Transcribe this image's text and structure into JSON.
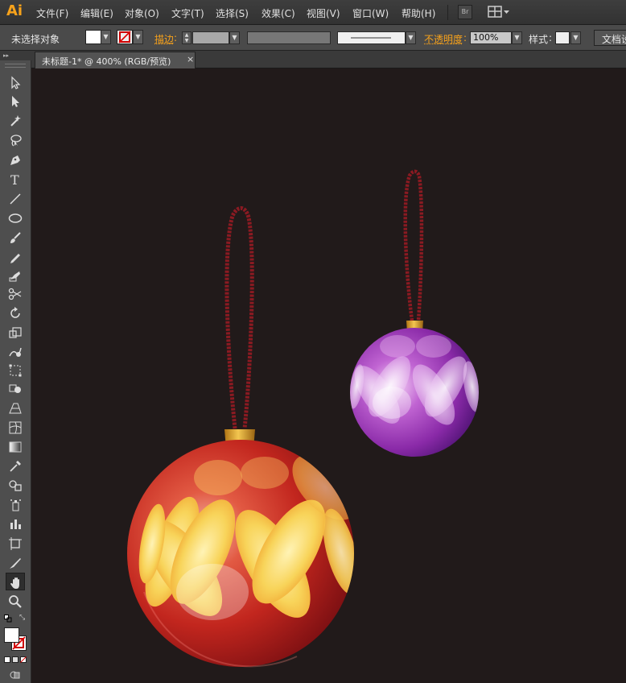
{
  "app": {
    "logo": "Ai"
  },
  "menu": {
    "items": [
      "文件(F)",
      "编辑(E)",
      "对象(O)",
      "文字(T)",
      "选择(S)",
      "效果(C)",
      "视图(V)",
      "窗口(W)",
      "帮助(H)"
    ]
  },
  "bridge_button": {
    "label": "Br"
  },
  "control_bar": {
    "selection_status": "未选择对象",
    "stroke_label": "描边",
    "opacity_label": "不透明度",
    "opacity_value": "100%",
    "style_label": "样式",
    "doc_setup_label": "文档设"
  },
  "document_tab": {
    "title": "未标题-1* @ 400% (RGB/预览)",
    "close": "×"
  },
  "colors": {
    "menubar_bg": "#353535",
    "panel_bg": "#4a4a4a",
    "canvas_bg": "#211a1a",
    "accent_label": "#f7a21b",
    "red_ornament": "#c0261f",
    "purple_ornament": "#8a2aa8",
    "ornament_pattern": "#f8d45a",
    "string": "#8b1a22",
    "cap": "#d9a52a"
  },
  "tools": [
    "selection-tool",
    "direct-selection-tool",
    "magic-wand-tool",
    "lasso-tool",
    "pen-tool",
    "type-tool",
    "line-segment-tool",
    "ellipse-tool",
    "paintbrush-tool",
    "pencil-tool",
    "blob-brush-tool",
    "scissors-tool",
    "rotate-tool",
    "scale-tool",
    "warp-tool",
    "free-transform-tool",
    "shape-builder-tool",
    "perspective-grid-tool",
    "mesh-tool",
    "gradient-tool",
    "eyedropper-tool",
    "blend-tool",
    "symbol-sprayer-tool",
    "column-graph-tool",
    "artboard-tool",
    "slice-tool",
    "hand-tool",
    "zoom-tool"
  ],
  "artwork": {
    "ornaments": [
      {
        "name": "red-ornament",
        "color": "red"
      },
      {
        "name": "purple-ornament",
        "color": "purple"
      }
    ]
  }
}
